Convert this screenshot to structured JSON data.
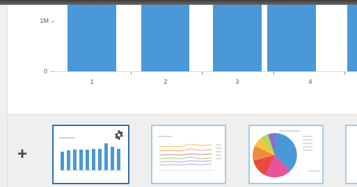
{
  "chart": {
    "y_ticks": [
      "1M",
      "0"
    ],
    "x_ticks": [
      "1",
      "2",
      "3",
      "4"
    ]
  },
  "toolbar": {
    "add_label": "+"
  },
  "thumbnails": [
    {
      "kind": "bar-chart",
      "selected": true
    },
    {
      "kind": "line-chart",
      "selected": false
    },
    {
      "kind": "pie-chart",
      "selected": false
    },
    {
      "kind": "chart",
      "selected": false
    }
  ],
  "colors": {
    "bar": "#4a98d8",
    "selected_border": "#2d6fae"
  }
}
